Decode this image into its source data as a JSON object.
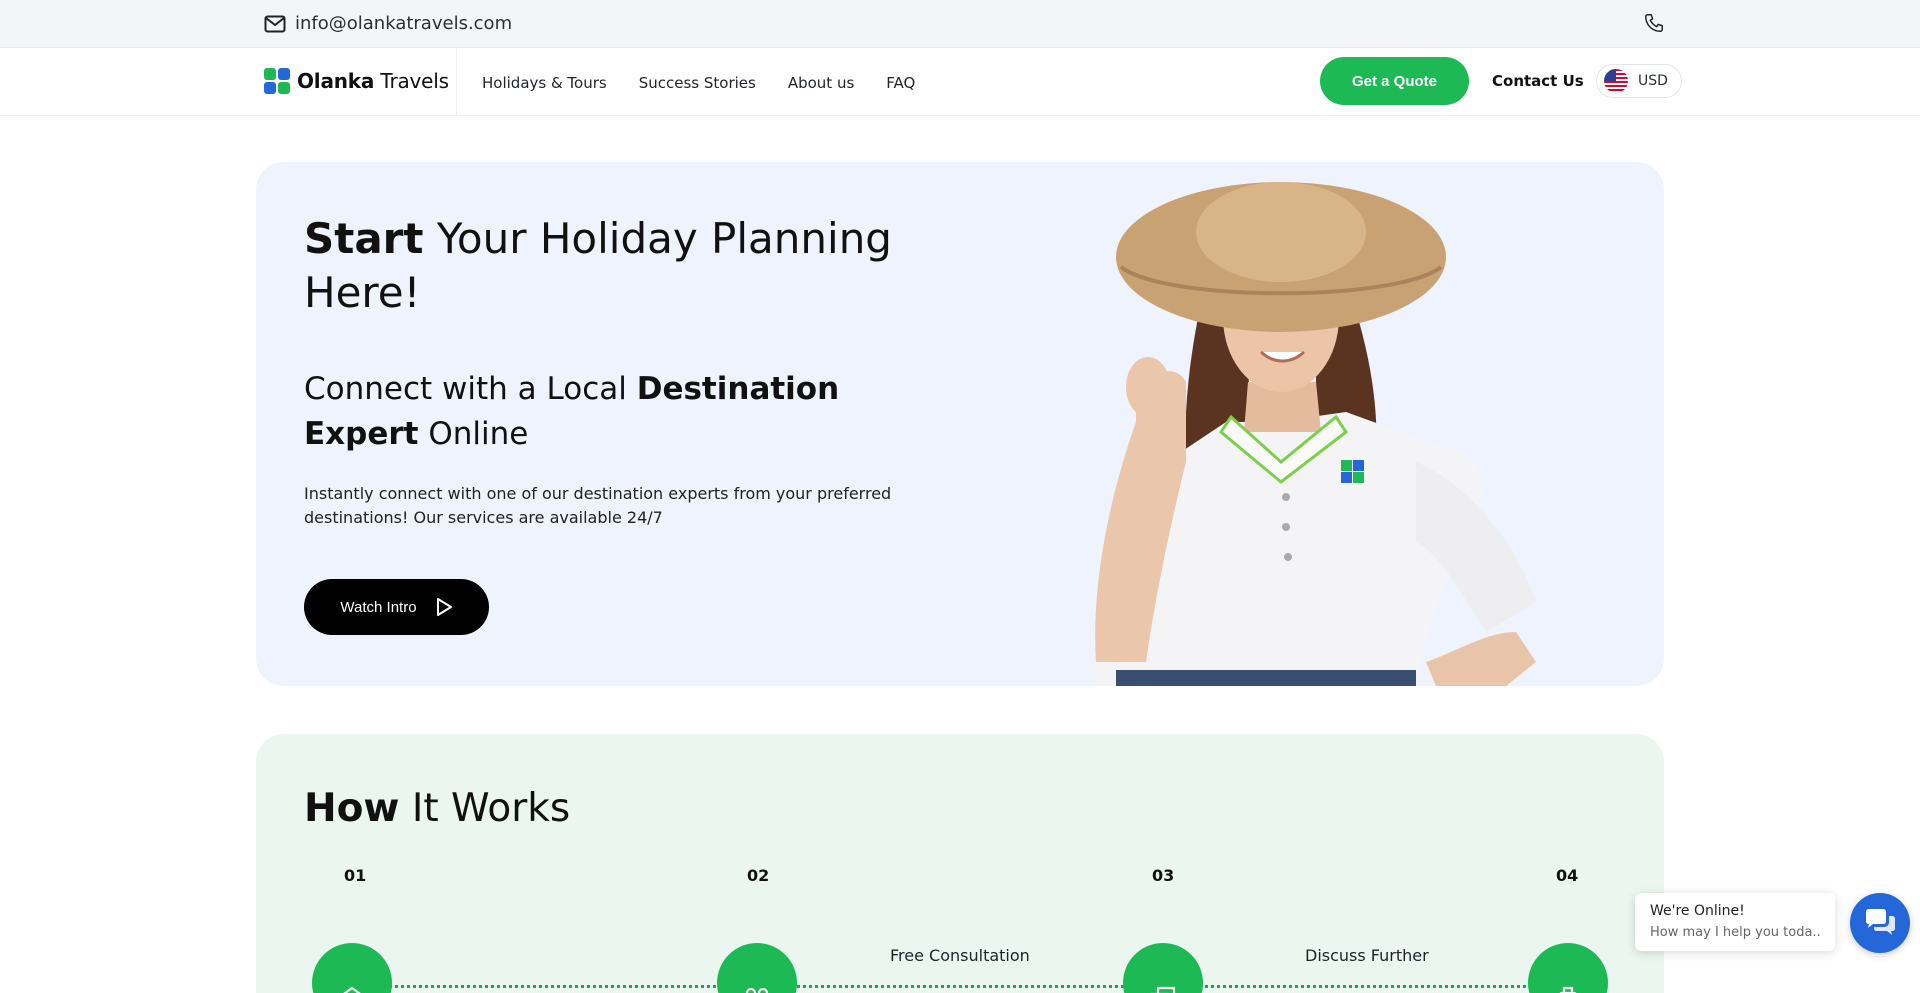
{
  "topbar": {
    "email": "info@olankatravels.com",
    "phone_icon": "phone-icon",
    "mail_icon": "mail-icon"
  },
  "nav": {
    "logo": {
      "bold": "Olanka",
      "rest": " Travels"
    },
    "menu": [
      "Holidays & Tours",
      "Success Stories",
      "About us",
      "FAQ"
    ],
    "quote": "Get a Quote",
    "contact": "Contact Us",
    "currency": "USD"
  },
  "hero": {
    "title_bold": "Start",
    "title_rest": " Your Holiday Planning Here!",
    "subtitle_pre": "Connect with a Local ",
    "subtitle_bold": "Destination Expert",
    "subtitle_post": " Online",
    "description": "Instantly connect with one of our destination experts from your preferred destinations! Our services are available 24/7",
    "watch": "Watch Intro"
  },
  "how": {
    "title_bold": "How",
    "title_rest": " It Works",
    "steps": [
      {
        "num": "01",
        "title": ""
      },
      {
        "num": "02",
        "title": "Free Consultation"
      },
      {
        "num": "03",
        "title": "Discuss Further"
      },
      {
        "num": "04",
        "title": ""
      }
    ]
  },
  "chat": {
    "title": "We're Online!",
    "subtitle": "How may I help you toda..."
  },
  "colors": {
    "green": "#1db954",
    "hero_bg": "#eef3fd",
    "how_bg": "#eaf6ef",
    "chat_blue": "#2367d8"
  }
}
